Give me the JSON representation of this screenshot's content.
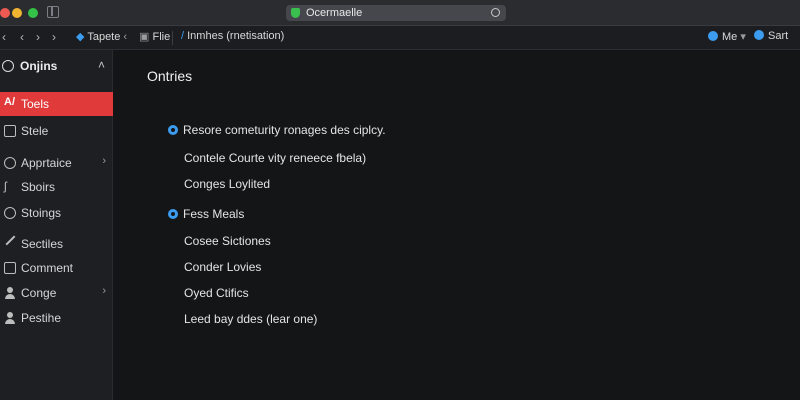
{
  "urlbar": {
    "text": "Ocermaelle"
  },
  "toolbar": {
    "tab1": "Tapete",
    "tab2": "Flie",
    "tab3": "Inmhes (rnetisation)",
    "me": "Me",
    "sort": "Sart"
  },
  "sidebar": {
    "header": "Onjins",
    "items": [
      {
        "label": "Toels",
        "icon": "tools-icon",
        "active": true
      },
      {
        "label": "Stele",
        "icon": "box-icon"
      },
      {
        "label": "Apprtaice",
        "icon": "palette-icon",
        "chevron": true
      },
      {
        "label": "Sboirs",
        "icon": "wave-icon"
      },
      {
        "label": "Stoings",
        "icon": "gear-icon"
      },
      {
        "label": "Sectiles",
        "icon": "wrench-icon"
      },
      {
        "label": "Comment",
        "icon": "comment-icon"
      },
      {
        "label": "Conge",
        "icon": "person-icon",
        "chevron": true
      },
      {
        "label": "Pestihe",
        "icon": "person-icon"
      }
    ]
  },
  "main": {
    "heading": "Ontries",
    "rows": [
      {
        "text": "Resore cometurity ronages des ciplcy.",
        "bullet": true
      },
      {
        "text": "Contele Courte vity reneece fbela)"
      },
      {
        "text": "Conges Loylited"
      },
      {
        "text": "Fess Meals",
        "bullet": true
      },
      {
        "text": "Cosee Sictiones"
      },
      {
        "text": "Conder Lovies"
      },
      {
        "text": "Oyed Ctifics"
      },
      {
        "text": "Leed bay ddes (lear one)"
      }
    ]
  }
}
